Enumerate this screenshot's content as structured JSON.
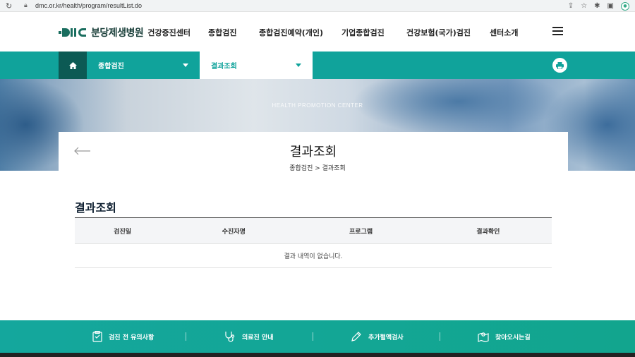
{
  "browser": {
    "url": "dmc.or.kr/health/program/resultList.do"
  },
  "header": {
    "logo_name": "분당제생병원",
    "logo_sub": "건강증진센터",
    "nav": [
      "종합검진",
      "종합검진예약(개인)",
      "기업종합검진",
      "건강보험(국가)검진",
      "센터소개"
    ]
  },
  "subnav": {
    "dropdown1": "종합검진",
    "dropdown2": "결과조회"
  },
  "hero": {
    "tagline": "HEALTH PROMOTION CENTER",
    "page_title": "결과조회"
  },
  "breadcrumb": "종합검진 > 결과조회",
  "section_title": "결과조회",
  "table": {
    "headers": [
      "검진일",
      "수진자명",
      "프로그램",
      "결과확인"
    ],
    "empty_message": "결과 내역이 없습니다."
  },
  "footer": {
    "items": [
      "검진 전 유의사항",
      "의료진 안내",
      "추가혈액검사",
      "찾아오시는길"
    ]
  },
  "colors": {
    "primary": "#10a39b",
    "dark": "#0c5a54"
  }
}
